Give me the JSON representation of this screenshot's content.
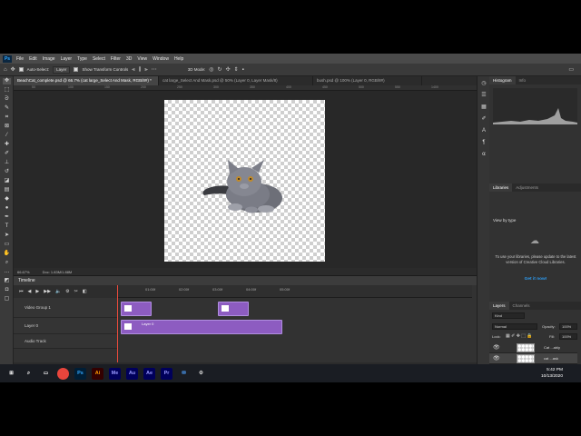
{
  "app": {
    "logo": "Ps",
    "menu": [
      "File",
      "Edit",
      "Image",
      "Layer",
      "Type",
      "Select",
      "Filter",
      "3D",
      "View",
      "Window",
      "Help"
    ]
  },
  "options_bar": {
    "auto_select_label": "Auto-Select:",
    "auto_select_value": "Layer",
    "show_transform_label": "Show Transform Controls",
    "mode_3d_label": "3D Mode:"
  },
  "doc_tabs": [
    "BeachCat_complete.psd @ 66.7% (cat large_Select And Mask, RGB/8#) *",
    "cat large_Select And Mask.psd @ 50% (Layer 0, Layer Mask/8)",
    "bush.psd @ 100% (Layer 0, RGB/8#)"
  ],
  "ruler_ticks": [
    "50",
    "100",
    "150",
    "200",
    "250",
    "300",
    "350",
    "400",
    "450",
    "500",
    "550",
    "1400"
  ],
  "status_bar": {
    "zoom": "66.67%",
    "doc_size": "Doc: 1.83M/1.88M"
  },
  "timeline": {
    "title": "Timeline",
    "time_ticks": [
      "01:00f",
      "02:00f",
      "03:00f",
      "04:00f",
      "05:00f"
    ],
    "tracks": [
      {
        "name": "Video Group 1"
      },
      {
        "name": "Layer 0"
      },
      {
        "name": "Audio Track"
      }
    ],
    "clip_label": "Layer 0",
    "current_time": "0:00:00:00",
    "fps": "(30.00 fps)"
  },
  "panels": {
    "top_tabs": [
      "Histogram",
      "Info"
    ],
    "mid_tabs": [
      "Libraries",
      "Adjustments"
    ],
    "view_by": "View by type",
    "libraries_message": "To use your libraries, please update to the latest version of Creative Cloud Libraries.",
    "libraries_link": "Get it now!",
    "layers_tabs": [
      "Layers",
      "Channels"
    ],
    "kind_label": "Kind",
    "blend_mode": "Normal",
    "opacity_label": "Opacity:",
    "opacity_value": "100%",
    "lock_label": "Lock:",
    "fill_label": "Fill:",
    "fill_value": "100%",
    "layers": [
      {
        "name": "Cat ...ably",
        "selected": false
      },
      {
        "name": "cat ...ask",
        "selected": true
      }
    ]
  },
  "taskbar": {
    "icons": [
      {
        "label": "Ps",
        "color": "#31a8ff",
        "bg": "#001e36"
      },
      {
        "label": "Ai",
        "color": "#ff9a00",
        "bg": "#330000"
      },
      {
        "label": "Me",
        "color": "#9999ff",
        "bg": "#00005b"
      },
      {
        "label": "Au",
        "color": "#9999ff",
        "bg": "#00005b"
      },
      {
        "label": "Ae",
        "color": "#9999ff",
        "bg": "#00005b"
      },
      {
        "label": "Pr",
        "color": "#9999ff",
        "bg": "#00005b"
      }
    ],
    "time": "5:42 PM",
    "date": "10/13/2020"
  },
  "colors": {
    "accent": "#31a8ff",
    "clip": "#8d5cc1",
    "playhead": "#e84a3c",
    "link": "#2d9bf0"
  }
}
